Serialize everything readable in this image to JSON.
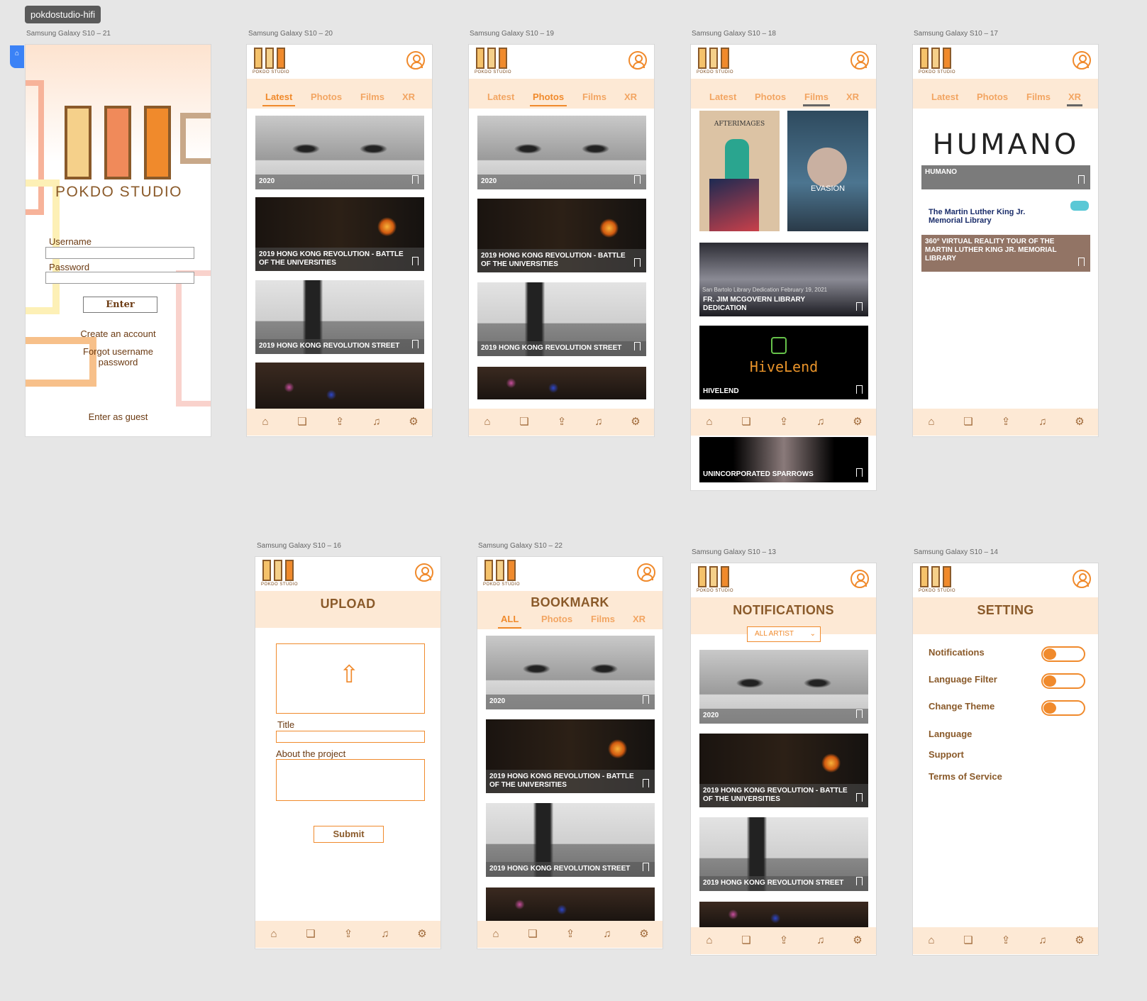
{
  "project_tag": "pokdostudio-hifi",
  "brand": {
    "name": "POKDO STUDIO",
    "accent": "#f08a2c",
    "soft": "#fde9d5",
    "text": "#8a5a2a"
  },
  "artboards": {
    "a21": "Samsung Galaxy S10 – 21",
    "a20": "Samsung Galaxy S10 – 20",
    "a19": "Samsung Galaxy S10 – 19",
    "a18": "Samsung Galaxy S10 – 18",
    "a17": "Samsung Galaxy S10 – 17",
    "a16": "Samsung Galaxy S10 – 16",
    "a22": "Samsung Galaxy S10 – 22",
    "a13": "Samsung Galaxy S10 – 13",
    "a14": "Samsung Galaxy S10 – 14"
  },
  "login": {
    "username_label": "Username",
    "password_label": "Password",
    "enter_label": "Enter",
    "create_account": "Create an account",
    "forgot_line1": "Forgot username",
    "forgot_line2": "password",
    "guest": "Enter as guest"
  },
  "tabs": {
    "latest": "Latest",
    "photos": "Photos",
    "films": "Films",
    "xr": "XR",
    "all": "ALL"
  },
  "cards": {
    "c2020": "2020",
    "battle": "2019 HONG KONG REVOLUTION - BATTLE OF THE UNIVERSITIES",
    "street": "2019 HONG KONG REVOLUTION STREET",
    "library": "FR. JIM MCGOVERN LIBRARY DEDICATION",
    "library_sub": "San Bartolo Library Dedication February 19, 2021",
    "hivelend": "HIVELEND",
    "hivelend_logo": "HiveLend",
    "sparrows": "UNINCORPORATED SPARROWS",
    "humano": "HUMANO",
    "humano_logo": "HUMANO",
    "mlk": "360° VIRTUAL REALITY TOUR OF THE MARTIN LUTHER KING JR. MEMORIAL LIBRARY",
    "mlk_banner": "The Martin Luther King Jr. Memorial Library",
    "afterimages": "AFTERIMAGES",
    "evasion": "EVASION"
  },
  "upload": {
    "title": "UPLOAD",
    "title_label": "Title",
    "about_label": "About the project",
    "submit": "Submit"
  },
  "bookmark": {
    "title": "BOOKMARK"
  },
  "notifications": {
    "title": "NOTIFICATIONS",
    "filter": "ALL ARTIST"
  },
  "settings": {
    "title": "SETTING",
    "notifications": "Notifications",
    "language_filter": "Language Filter",
    "change_theme": "Change Theme",
    "language": "Language",
    "support": "Support",
    "terms": "Terms of Service"
  },
  "icons": [
    "home-icon",
    "bookmark-icon",
    "upload-icon",
    "bell-icon",
    "gear-icon",
    "user-icon"
  ]
}
